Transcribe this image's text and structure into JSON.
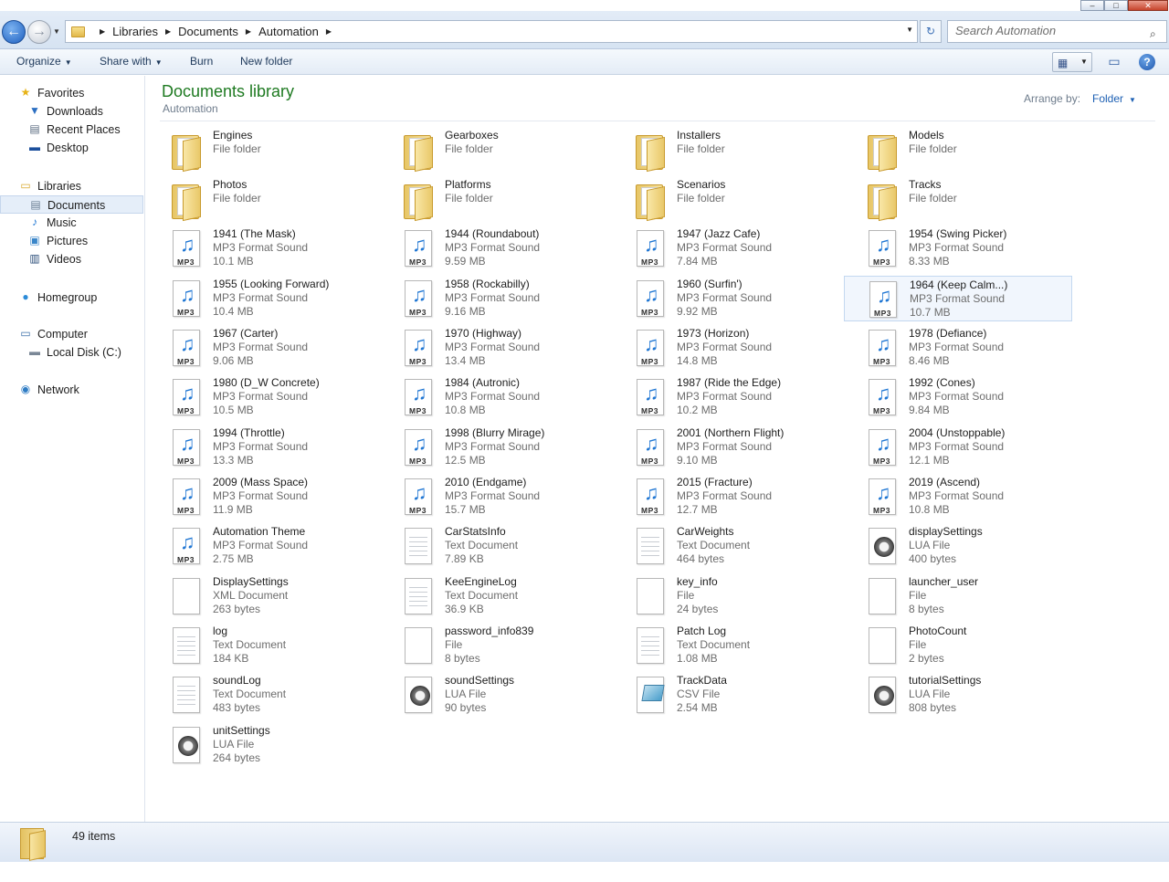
{
  "window": {
    "controls": {
      "minimize": "–",
      "maximize": "□",
      "close": "✕"
    }
  },
  "address_bar": {
    "breadcrumbs": [
      "Libraries",
      "Documents",
      "Automation"
    ],
    "search_placeholder": "Search Automation",
    "back_glyph": "←",
    "forward_glyph": "→",
    "refresh_glyph": "↻"
  },
  "toolbar": {
    "organize": "Organize",
    "share_with": "Share with",
    "burn": "Burn",
    "new_folder": "New folder",
    "help": "?"
  },
  "sidebar": {
    "favorites": {
      "label": "Favorites",
      "items": [
        "Downloads",
        "Recent Places",
        "Desktop"
      ]
    },
    "libraries": {
      "label": "Libraries",
      "items": [
        "Documents",
        "Music",
        "Pictures",
        "Videos"
      ]
    },
    "homegroup": "Homegroup",
    "computer": {
      "label": "Computer",
      "items": [
        "Local Disk (C:)"
      ]
    },
    "network": "Network"
  },
  "content": {
    "title": "Documents library",
    "subtitle": "Automation",
    "arrange_label": "Arrange by:",
    "arrange_value": "Folder"
  },
  "items": [
    {
      "name": "Engines",
      "type": "File folder",
      "size": "",
      "icon": "folder-icon"
    },
    {
      "name": "Gearboxes",
      "type": "File folder",
      "size": "",
      "icon": "folder-icon"
    },
    {
      "name": "Installers",
      "type": "File folder",
      "size": "",
      "icon": "folder-icon"
    },
    {
      "name": "Models",
      "type": "File folder",
      "size": "",
      "icon": "folder-icon"
    },
    {
      "name": "Photos",
      "type": "File folder",
      "size": "",
      "icon": "folder-icon"
    },
    {
      "name": "Platforms",
      "type": "File folder",
      "size": "",
      "icon": "folder-icon"
    },
    {
      "name": "Scenarios",
      "type": "File folder",
      "size": "",
      "icon": "folder-icon"
    },
    {
      "name": "Tracks",
      "type": "File folder",
      "size": "",
      "icon": "folder-icon"
    },
    {
      "name": "1941 (The Mask)",
      "type": "MP3 Format Sound",
      "size": "10.1 MB",
      "icon": "mp3-icon"
    },
    {
      "name": "1944 (Roundabout)",
      "type": "MP3 Format Sound",
      "size": "9.59 MB",
      "icon": "mp3-icon"
    },
    {
      "name": "1947 (Jazz Cafe)",
      "type": "MP3 Format Sound",
      "size": "7.84 MB",
      "icon": "mp3-icon"
    },
    {
      "name": "1954 (Swing Picker)",
      "type": "MP3 Format Sound",
      "size": "8.33 MB",
      "icon": "mp3-icon"
    },
    {
      "name": "1955 (Looking Forward)",
      "type": "MP3 Format Sound",
      "size": "10.4 MB",
      "icon": "mp3-icon"
    },
    {
      "name": "1958 (Rockabilly)",
      "type": "MP3 Format Sound",
      "size": "9.16 MB",
      "icon": "mp3-icon"
    },
    {
      "name": "1960 (Surfin')",
      "type": "MP3 Format Sound",
      "size": "9.92 MB",
      "icon": "mp3-icon"
    },
    {
      "name": "1964 (Keep Calm...)",
      "type": "MP3 Format Sound",
      "size": "10.7 MB",
      "icon": "mp3-icon",
      "hot": true
    },
    {
      "name": "1967 (Carter)",
      "type": "MP3 Format Sound",
      "size": "9.06 MB",
      "icon": "mp3-icon"
    },
    {
      "name": "1970 (Highway)",
      "type": "MP3 Format Sound",
      "size": "13.4 MB",
      "icon": "mp3-icon"
    },
    {
      "name": "1973 (Horizon)",
      "type": "MP3 Format Sound",
      "size": "14.8 MB",
      "icon": "mp3-icon"
    },
    {
      "name": "1978 (Defiance)",
      "type": "MP3 Format Sound",
      "size": "8.46 MB",
      "icon": "mp3-icon"
    },
    {
      "name": "1980 (D_W Concrete)",
      "type": "MP3 Format Sound",
      "size": "10.5 MB",
      "icon": "mp3-icon"
    },
    {
      "name": "1984 (Autronic)",
      "type": "MP3 Format Sound",
      "size": "10.8 MB",
      "icon": "mp3-icon"
    },
    {
      "name": "1987 (Ride the Edge)",
      "type": "MP3 Format Sound",
      "size": "10.2 MB",
      "icon": "mp3-icon"
    },
    {
      "name": "1992 (Cones)",
      "type": "MP3 Format Sound",
      "size": "9.84 MB",
      "icon": "mp3-icon"
    },
    {
      "name": "1994 (Throttle)",
      "type": "MP3 Format Sound",
      "size": "13.3 MB",
      "icon": "mp3-icon"
    },
    {
      "name": "1998 (Blurry Mirage)",
      "type": "MP3 Format Sound",
      "size": "12.5 MB",
      "icon": "mp3-icon"
    },
    {
      "name": "2001 (Northern Flight)",
      "type": "MP3 Format Sound",
      "size": "9.10 MB",
      "icon": "mp3-icon"
    },
    {
      "name": "2004 (Unstoppable)",
      "type": "MP3 Format Sound",
      "size": "12.1 MB",
      "icon": "mp3-icon"
    },
    {
      "name": "2009 (Mass Space)",
      "type": "MP3 Format Sound",
      "size": "11.9 MB",
      "icon": "mp3-icon"
    },
    {
      "name": "2010 (Endgame)",
      "type": "MP3 Format Sound",
      "size": "15.7 MB",
      "icon": "mp3-icon"
    },
    {
      "name": "2015 (Fracture)",
      "type": "MP3 Format Sound",
      "size": "12.7 MB",
      "icon": "mp3-icon"
    },
    {
      "name": "2019 (Ascend)",
      "type": "MP3 Format Sound",
      "size": "10.8 MB",
      "icon": "mp3-icon"
    },
    {
      "name": "Automation Theme",
      "type": "MP3 Format Sound",
      "size": "2.75 MB",
      "icon": "mp3-icon"
    },
    {
      "name": "CarStatsInfo",
      "type": "Text Document",
      "size": "7.89 KB",
      "icon": "text-document-icon"
    },
    {
      "name": "CarWeights",
      "type": "Text Document",
      "size": "464 bytes",
      "icon": "text-document-icon"
    },
    {
      "name": "displaySettings",
      "type": "LUA File",
      "size": "400 bytes",
      "icon": "lua-file-icon"
    },
    {
      "name": "DisplaySettings",
      "type": "XML Document",
      "size": "263 bytes",
      "icon": "blank-file-icon"
    },
    {
      "name": "KeeEngineLog",
      "type": "Text Document",
      "size": "36.9 KB",
      "icon": "text-document-icon"
    },
    {
      "name": "key_info",
      "type": "File",
      "size": "24 bytes",
      "icon": "blank-file-icon"
    },
    {
      "name": "launcher_user",
      "type": "File",
      "size": "8 bytes",
      "icon": "blank-file-icon"
    },
    {
      "name": "log",
      "type": "Text Document",
      "size": "184 KB",
      "icon": "text-document-icon"
    },
    {
      "name": "password_info839",
      "type": "File",
      "size": "8 bytes",
      "icon": "blank-file-icon"
    },
    {
      "name": "Patch Log",
      "type": "Text Document",
      "size": "1.08 MB",
      "icon": "text-document-icon"
    },
    {
      "name": "PhotoCount",
      "type": "File",
      "size": "2 bytes",
      "icon": "blank-file-icon"
    },
    {
      "name": "soundLog",
      "type": "Text Document",
      "size": "483 bytes",
      "icon": "text-document-icon"
    },
    {
      "name": "soundSettings",
      "type": "LUA File",
      "size": "90 bytes",
      "icon": "lua-file-icon"
    },
    {
      "name": "TrackData",
      "type": "CSV File",
      "size": "2.54 MB",
      "icon": "csv-file-icon"
    },
    {
      "name": "tutorialSettings",
      "type": "LUA File",
      "size": "808 bytes",
      "icon": "lua-file-icon"
    },
    {
      "name": "unitSettings",
      "type": "LUA File",
      "size": "264 bytes",
      "icon": "lua-file-icon"
    }
  ],
  "statusbar": {
    "count": "49 items"
  }
}
